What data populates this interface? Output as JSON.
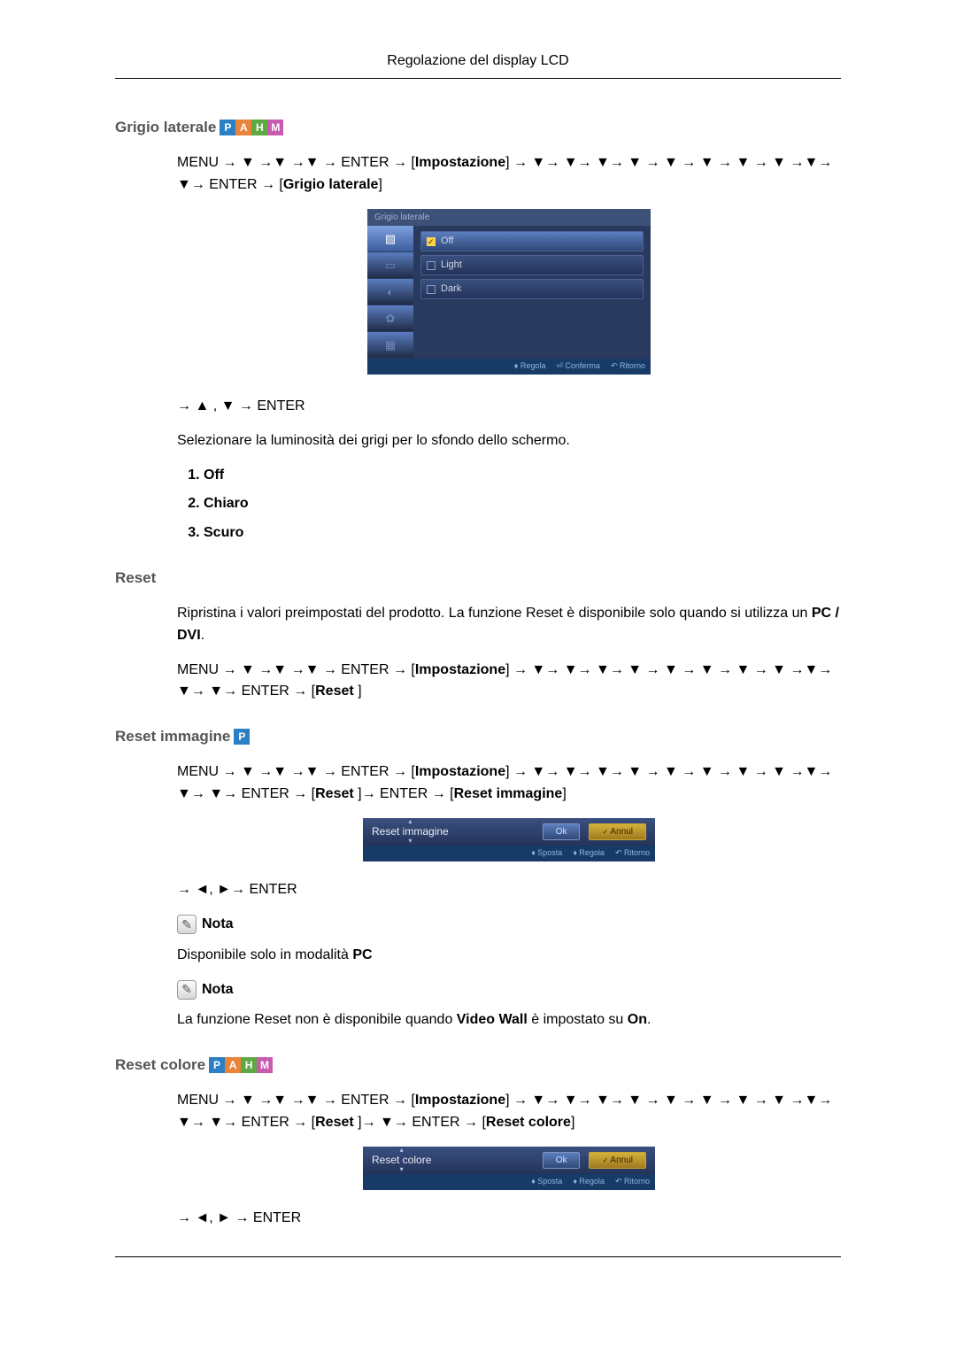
{
  "header": {
    "title": "Regolazione del display LCD"
  },
  "badges": {
    "p": "P",
    "a": "A",
    "h": "H",
    "m": "M"
  },
  "sec1": {
    "heading": "Grigio laterale",
    "path1": "MENU → ▼ →▼ →▼ → ENTER → [",
    "path1_bold": "Impostazione",
    "path1_cont": "] → ▼→ ▼→ ▼→ ▼ → ▼ → ▼ → ▼ → ▼ →▼→ ▼→ ENTER → [",
    "path1_bold2": "Grigio laterale",
    "path1_end": "]",
    "osd_title": "Grigio laterale",
    "osd_items": [
      "Off",
      "Light",
      "Dark"
    ],
    "osd_foot": {
      "a": "Regola",
      "b": "Conferma",
      "c": "Ritorno"
    },
    "nav": "→ ▲ , ▼ → ENTER",
    "desc": "Selezionare la luminosità dei grigi per lo sfondo dello schermo.",
    "opt1": "Off",
    "opt2": "Chiaro",
    "opt3": "Scuro"
  },
  "sec2": {
    "heading": "Reset",
    "desc_a": "Ripristina i valori preimpostati del prodotto. La funzione Reset è disponibile solo quando si utilizza un ",
    "desc_bold": "PC / DVI",
    "desc_b": ".",
    "path_a": "MENU → ▼ →▼ →▼ → ENTER → [",
    "path_bold1": "Impostazione",
    "path_b": "] → ▼→ ▼→ ▼→ ▼ → ▼ → ▼ → ▼ → ▼ →▼→ ▼→ ▼→ ENTER → [",
    "path_bold2": "Reset",
    "path_c": " ]"
  },
  "sec3": {
    "heading": "Reset immagine",
    "path_a": "MENU → ▼ →▼ →▼ → ENTER → [",
    "path_bold1": "Impostazione",
    "path_b": "] → ▼→ ▼→ ▼→ ▼ → ▼ → ▼ → ▼ → ▼ →▼→ ▼→ ▼→ ENTER → [",
    "path_bold2": "Reset",
    "path_c": " ]→ ENTER → [",
    "path_bold3": "Reset immagine",
    "path_d": "]",
    "dlg_name": "Reset immagine",
    "dlg_ok": "Ok",
    "dlg_cancel": "Annul",
    "dlg_foot": {
      "a": "Sposta",
      "b": "Regola",
      "c": "Ritorno"
    },
    "nav": "→ ◄, ►→ ENTER",
    "nota": "Nota",
    "note1_a": "Disponibile solo in modalità ",
    "note1_b": "PC",
    "note2_a": "La funzione Reset non è disponibile quando ",
    "note2_b": "Video Wall",
    "note2_c": " è impostato su ",
    "note2_d": "On",
    "note2_e": "."
  },
  "sec4": {
    "heading": "Reset colore",
    "path_a": "MENU → ▼ →▼ →▼ → ENTER → [",
    "path_bold1": "Impostazione",
    "path_b": "] → ▼→ ▼→ ▼→ ▼ → ▼ → ▼ → ▼ → ▼ →▼→ ▼→ ▼→ ENTER → [",
    "path_bold2": "Reset",
    "path_c": " ]→ ▼→ ENTER → [",
    "path_bold3": "Reset colore",
    "path_d": "]",
    "dlg_name": "Reset colore",
    "dlg_ok": "Ok",
    "dlg_cancel": "Annul",
    "dlg_foot": {
      "a": "Sposta",
      "b": "Regola",
      "c": "Ritorno"
    },
    "nav": "→ ◄, ► → ENTER"
  }
}
